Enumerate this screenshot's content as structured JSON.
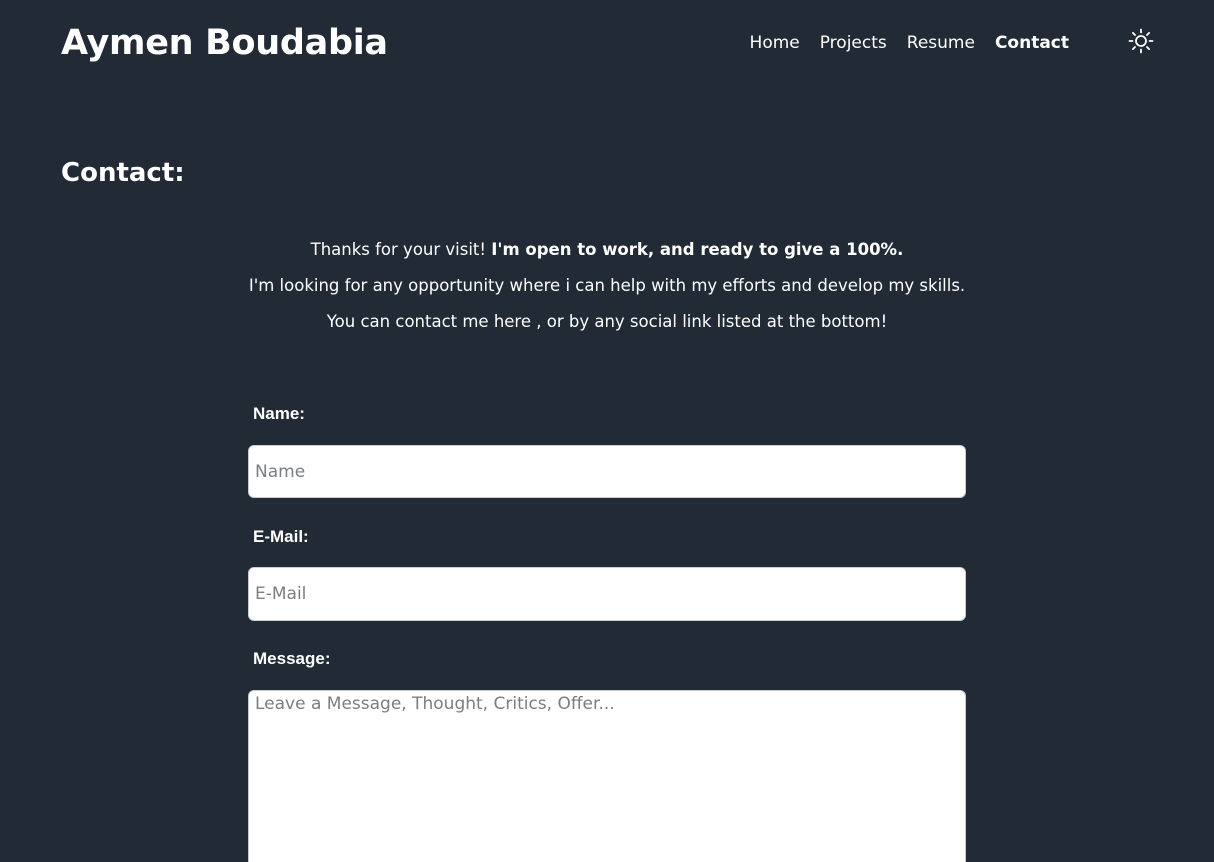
{
  "header": {
    "title": "Aymen Boudabia",
    "nav": [
      {
        "label": "Home",
        "active": false
      },
      {
        "label": "Projects",
        "active": false
      },
      {
        "label": "Resume",
        "active": false
      },
      {
        "label": "Contact",
        "active": true
      }
    ],
    "theme_toggle_icon": "sun-icon"
  },
  "contact": {
    "heading": "Contact:",
    "intro": {
      "line1_prefix": "Thanks for your visit! ",
      "line1_bold": "I'm open to work, and ready to give a 100%.",
      "line2": "I'm looking for any opportunity where i can help with my efforts and develop my skills.",
      "line3": "You can contact me here , or by any social link listed at the bottom!"
    },
    "form": {
      "name_label": "Name:",
      "name_placeholder": "Name",
      "name_value": "",
      "email_label": "E-Mail:",
      "email_placeholder": "E-Mail",
      "email_value": "",
      "message_label": "Message:",
      "message_placeholder": "Leave a Message, Thought, Critics, Offer...",
      "message_value": ""
    }
  },
  "colors": {
    "background": "#222a36",
    "text": "#ffffff",
    "field_background": "#ffffff",
    "field_border": "#c9ccd1"
  }
}
